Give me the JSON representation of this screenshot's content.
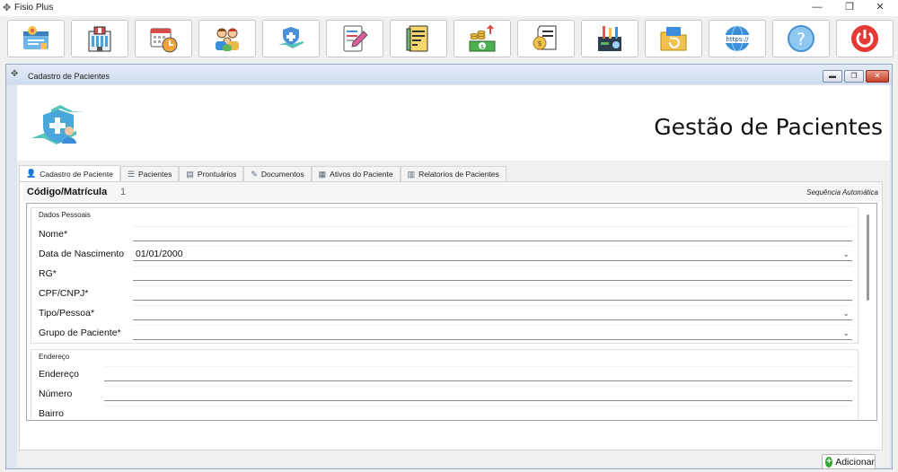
{
  "window": {
    "title": "Fisio Plus",
    "icon": "fisio-app-icon"
  },
  "toolbar": {
    "buttons": [
      {
        "name": "patient-card-icon"
      },
      {
        "name": "clinic-building-icon"
      },
      {
        "name": "calendar-clock-icon"
      },
      {
        "name": "family-group-icon"
      },
      {
        "name": "hand-shield-icon"
      },
      {
        "name": "document-pencil-icon"
      },
      {
        "name": "report-paper-icon"
      },
      {
        "name": "money-cash-icon"
      },
      {
        "name": "payment-receipt-icon"
      },
      {
        "name": "tools-settings-icon"
      },
      {
        "name": "backup-folder-icon"
      },
      {
        "name": "https-globe-icon"
      },
      {
        "name": "help-icon"
      },
      {
        "name": "power-exit-icon"
      }
    ]
  },
  "child_window": {
    "title": "Cadastro de Pacientes"
  },
  "header": {
    "title": "Gestão de Pacientes"
  },
  "tabs": [
    {
      "label": "Cadastro de Paciente",
      "icon": "user-icon",
      "active": true
    },
    {
      "label": "Pacientes",
      "icon": "list-icon"
    },
    {
      "label": "Prontuários",
      "icon": "folder-icon"
    },
    {
      "label": "Documentos",
      "icon": "document-icon"
    },
    {
      "label": "Ativos do Paciente",
      "icon": "assets-icon"
    },
    {
      "label": "Relatorios de Pacientes",
      "icon": "report-icon"
    }
  ],
  "code": {
    "label": "Código/Matrícula",
    "value": "1",
    "note": "Sequência Automática"
  },
  "personal": {
    "title": "Dados Pessoais",
    "fields": [
      {
        "label": "Nome*",
        "value": ""
      },
      {
        "label": "Data de Nascimento",
        "value": "01/01/2000",
        "dropdown": true
      },
      {
        "label": "RG*",
        "value": ""
      },
      {
        "label": "CPF/CNPJ*",
        "value": ""
      },
      {
        "label": "Tipo/Pessoa*",
        "value": "",
        "dropdown": true
      },
      {
        "label": "Grupo de Paciente*",
        "value": "",
        "dropdown": true
      }
    ]
  },
  "address": {
    "title": "Endereço",
    "fields": [
      {
        "label": "Endereço",
        "value": ""
      },
      {
        "label": "Número",
        "value": ""
      },
      {
        "label": "Bairro",
        "value": ""
      }
    ]
  },
  "actions": {
    "add_label": "Adicionar"
  }
}
